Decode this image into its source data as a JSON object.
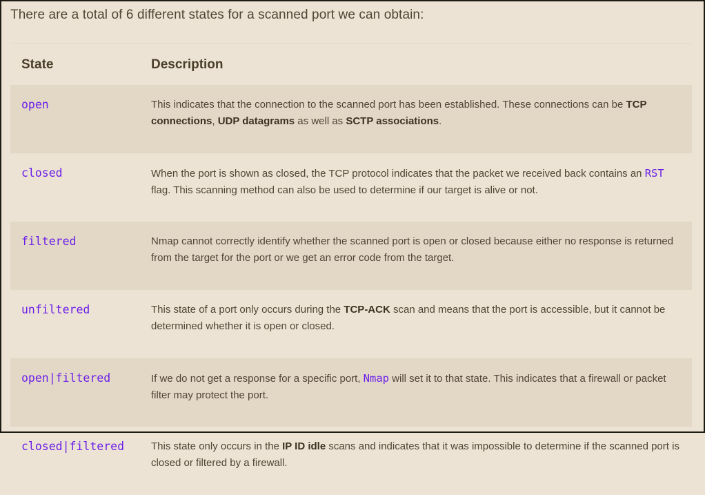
{
  "intro": "There are a total of 6 different states for a scanned port we can obtain:",
  "table": {
    "headers": {
      "state": "State",
      "description": "Description"
    },
    "rows": [
      {
        "state": "open",
        "parts": [
          {
            "t": "This indicates that the connection to the scanned port has been established. These connections can be "
          },
          {
            "b": "TCP connections"
          },
          {
            "t": ", "
          },
          {
            "b": "UDP datagrams"
          },
          {
            "t": " as well as "
          },
          {
            "b": "SCTP associations"
          },
          {
            "t": "."
          }
        ]
      },
      {
        "state": "closed",
        "parts": [
          {
            "t": "When the port is shown as closed, the TCP protocol indicates that the packet we received back contains an "
          },
          {
            "c": "RST"
          },
          {
            "t": " flag. This scanning method can also be used to determine if our target is alive or not."
          }
        ]
      },
      {
        "state": "filtered",
        "parts": [
          {
            "t": "Nmap cannot correctly identify whether the scanned port is open or closed because either no response is returned from the target for the port or we get an error code from the target."
          }
        ]
      },
      {
        "state": "unfiltered",
        "parts": [
          {
            "t": "This state of a port only occurs during the "
          },
          {
            "b": "TCP-ACK"
          },
          {
            "t": " scan and means that the port is accessible, but it cannot be determined whether it is open or closed."
          }
        ]
      },
      {
        "state": "open|filtered",
        "parts": [
          {
            "t": "If we do not get a response for a specific port, "
          },
          {
            "c": "Nmap"
          },
          {
            "t": " will set it to that state. This indicates that a firewall or packet filter may protect the port."
          }
        ]
      },
      {
        "state": "closed|filtered",
        "parts": [
          {
            "t": "This state only occurs in the "
          },
          {
            "b": "IP ID idle"
          },
          {
            "t": " scans and indicates that it was impossible to determine if the scanned port is closed or filtered by a firewall."
          }
        ]
      }
    ]
  },
  "colors": {
    "background": "#ede3d4",
    "stripe": "#e3d8c6",
    "text": "#4f4535",
    "code": "#6a1ee8",
    "border": "#1e1a14"
  }
}
